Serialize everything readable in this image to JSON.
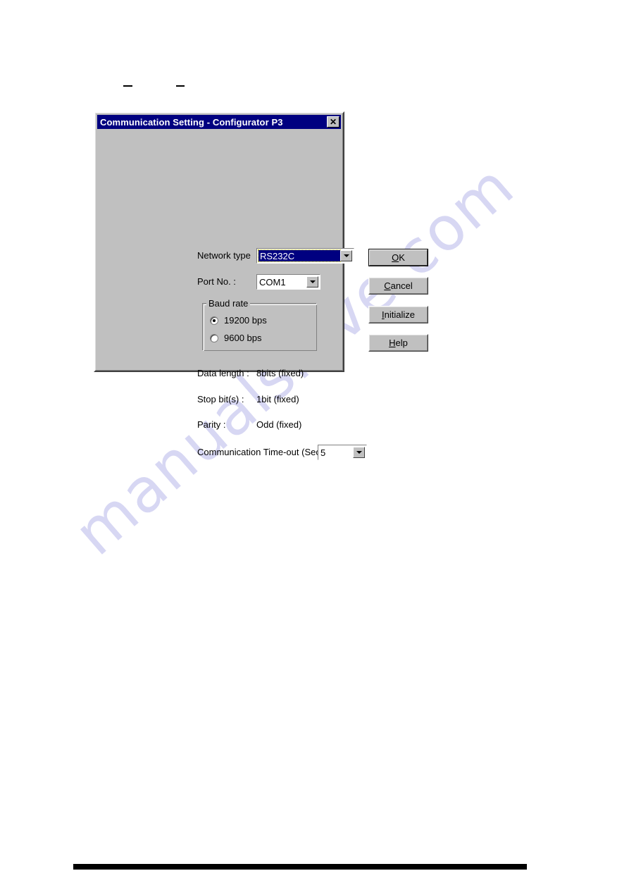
{
  "page": {
    "watermark_text": "manualshive.com",
    "footer_rule": "",
    "scan_mark": ""
  },
  "dialog": {
    "title": "Communication Setting - Configurator P3",
    "close_icon": "close-icon",
    "close_glyph": "✕",
    "fields": {
      "network_type": {
        "label": "Network type",
        "value": "RS232C",
        "arrow_icon": "chevron-down-icon"
      },
      "port_no": {
        "label": "Port No. :",
        "value": "COM1",
        "arrow_icon": "chevron-down-icon"
      },
      "baud_rate": {
        "legend": "Baud rate",
        "options": [
          {
            "label": "19200 bps",
            "selected": true
          },
          {
            "label": "9600 bps",
            "selected": false
          }
        ]
      },
      "data_length": {
        "label": "Data length :",
        "value": "8bits (fixed)"
      },
      "stop_bits": {
        "label": "Stop bit(s) :",
        "value": "1bit (fixed)"
      },
      "parity": {
        "label": "Parity :",
        "value": "Odd (fixed)"
      },
      "timeout": {
        "label": "Communication Time-out (Sec) :",
        "value": "5",
        "arrow_icon": "chevron-down-icon"
      }
    },
    "buttons": {
      "ok": {
        "mnemonic": "O",
        "before": "",
        "after": "K"
      },
      "cancel": {
        "mnemonic": "C",
        "before": "",
        "after": "ancel"
      },
      "initialize": {
        "mnemonic": "I",
        "before": "",
        "after": "nitialize"
      },
      "help": {
        "mnemonic": "H",
        "before": "",
        "after": "elp"
      }
    }
  },
  "colors": {
    "titlebar": "#000080",
    "dialog_face": "#c0c0c0",
    "selection": "#000080",
    "watermark": "#d7d7f3"
  }
}
